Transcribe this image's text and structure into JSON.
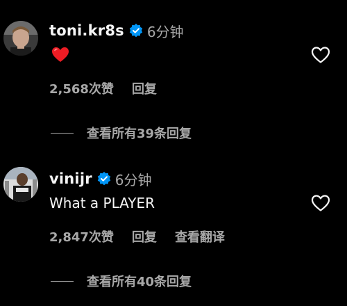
{
  "comments": [
    {
      "username": "toni.kr8s",
      "time": "6分钟",
      "text": "",
      "emoji": "red-heart-emoji",
      "likes": "2,568次赞",
      "reply_label": "回复",
      "view_replies": "查看所有39条回复"
    },
    {
      "username": "vinijr",
      "time": "6分钟",
      "text": "What a PLAYER",
      "likes": "2,847次赞",
      "reply_label": "回复",
      "translate_label": "查看翻译",
      "view_replies": "查看所有40条回复"
    }
  ],
  "colors": {
    "background": "#000000",
    "primary_text": "#f5f5f5",
    "secondary_text": "#a8a8a8",
    "verified_blue": "#0095f6",
    "heart_red": "#ed1c24"
  },
  "icons": {
    "verified": "verified-badge-icon",
    "like": "heart-outline-icon"
  }
}
